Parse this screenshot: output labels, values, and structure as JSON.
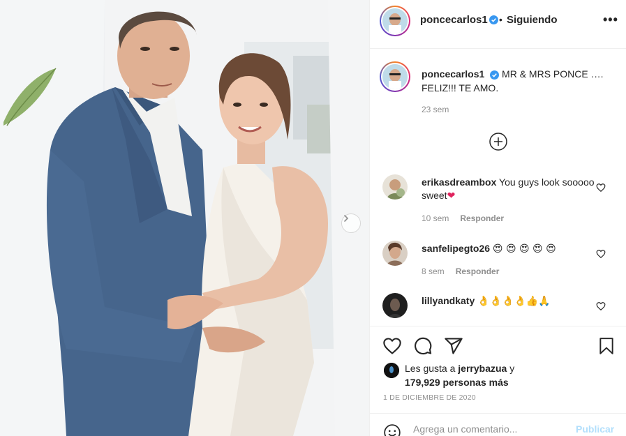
{
  "post": {
    "author": "poncecarlos1",
    "verified": true,
    "follow_status": "Siguiendo",
    "separator": "•",
    "caption": "MR & MRS PONCE …. FELIZ!!! TE AMO.",
    "caption_time": "23 sem"
  },
  "comments": [
    {
      "user": "erikasdreambox",
      "text": "You guys look sooooo sweet",
      "emoji": "❤",
      "time": "10 sem",
      "reply": "Responder"
    },
    {
      "user": "sanfelipegto26",
      "text": "",
      "emoji": "😍 😍 😍 😍 😍",
      "time": "8 sem",
      "reply": "Responder"
    },
    {
      "user": "lillyandkaty",
      "text": "",
      "emoji": "👌👌👌👌👍🙏",
      "time": "",
      "reply": ""
    }
  ],
  "likes": {
    "prefix": "Les gusta a",
    "user": "jerrybazua",
    "suffix": "y",
    "count_text": "179,929 personas más"
  },
  "date": "1 DE DICIEMBRE DE 2020",
  "add_comment": {
    "placeholder": "Agrega un comentario...",
    "publish": "Publicar"
  },
  "icons": [
    "verified-icon",
    "more-icon",
    "load-more-icon",
    "heart-icon",
    "comment-icon",
    "share-icon",
    "save-icon",
    "smile-icon",
    "chevron-right-icon"
  ],
  "colors": {
    "accent": "#0095f6",
    "verified": "#3897f0",
    "muted": "#8e8e8e",
    "publish_disabled": "#b2dffc"
  }
}
